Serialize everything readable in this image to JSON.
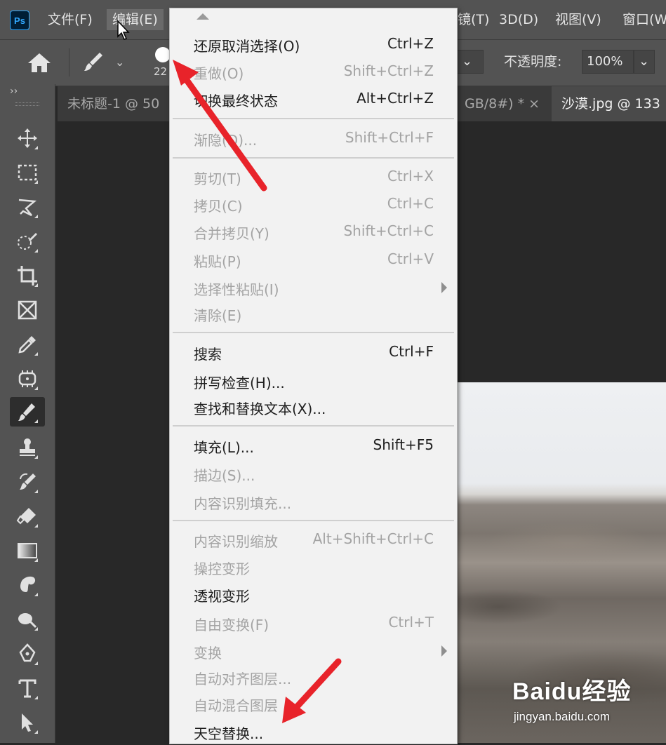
{
  "app": {
    "logo_text": "Ps"
  },
  "menubar": {
    "items": [
      "文件(F)",
      "编辑(E)",
      "镜(T)",
      "3D(D)",
      "视图(V)",
      "窗口(W"
    ]
  },
  "options": {
    "brush_size": "22",
    "opacity_label": "不透明度:",
    "opacity_value": "100%"
  },
  "tabs": [
    {
      "label": "未标题-1 @ 50",
      "active": false
    },
    {
      "label": "GB/8#) * ×",
      "active": false
    },
    {
      "label": "沙漠.jpg @ 133",
      "active": true
    }
  ],
  "toolbar": {
    "expand_label": "››",
    "tools": [
      "move-tool",
      "marquee-tool",
      "lasso-tool",
      "quick-selection-tool",
      "crop-tool",
      "frame-tool",
      "eyedropper-tool",
      "healing-tool",
      "brush-tool",
      "stamp-tool",
      "history-brush-tool",
      "eraser-tool",
      "gradient-tool",
      "blur-tool",
      "dodge-tool",
      "pen-tool",
      "type-tool",
      "path-selection-tool"
    ],
    "active": "brush-tool"
  },
  "edit_menu": {
    "items": [
      {
        "label": "还原取消选择(O)",
        "shortcut": "Ctrl+Z",
        "enabled": true
      },
      {
        "label": "重做(O)",
        "shortcut": "Shift+Ctrl+Z",
        "enabled": false
      },
      {
        "label": "切换最终状态",
        "shortcut": "Alt+Ctrl+Z",
        "enabled": true
      },
      {
        "label": "渐隐(D)...",
        "shortcut": "Shift+Ctrl+F",
        "enabled": false
      },
      {
        "label": "剪切(T)",
        "shortcut": "Ctrl+X",
        "enabled": false
      },
      {
        "label": "拷贝(C)",
        "shortcut": "Ctrl+C",
        "enabled": false
      },
      {
        "label": "合并拷贝(Y)",
        "shortcut": "Shift+Ctrl+C",
        "enabled": false
      },
      {
        "label": "粘贴(P)",
        "shortcut": "Ctrl+V",
        "enabled": false
      },
      {
        "label": "选择性粘贴(I)",
        "shortcut": "",
        "enabled": false,
        "submenu": true
      },
      {
        "label": "清除(E)",
        "shortcut": "",
        "enabled": false
      },
      {
        "label": "搜索",
        "shortcut": "Ctrl+F",
        "enabled": true
      },
      {
        "label": "拼写检查(H)...",
        "shortcut": "",
        "enabled": true
      },
      {
        "label": "查找和替换文本(X)...",
        "shortcut": "",
        "enabled": true
      },
      {
        "label": "填充(L)...",
        "shortcut": "Shift+F5",
        "enabled": true
      },
      {
        "label": "描边(S)...",
        "shortcut": "",
        "enabled": false
      },
      {
        "label": "内容识别填充...",
        "shortcut": "",
        "enabled": false
      },
      {
        "label": "内容识别缩放",
        "shortcut": "Alt+Shift+Ctrl+C",
        "enabled": false
      },
      {
        "label": "操控变形",
        "shortcut": "",
        "enabled": false
      },
      {
        "label": "透视变形",
        "shortcut": "",
        "enabled": true
      },
      {
        "label": "自由变换(F)",
        "shortcut": "Ctrl+T",
        "enabled": false
      },
      {
        "label": "变换",
        "shortcut": "",
        "enabled": false,
        "submenu": true
      },
      {
        "label": "自动对齐图层...",
        "shortcut": "",
        "enabled": false
      },
      {
        "label": "自动混合图层",
        "shortcut": "",
        "enabled": false
      },
      {
        "label": "天空替换...",
        "shortcut": "",
        "enabled": true
      }
    ]
  },
  "watermark": {
    "logo": "Baidu经验",
    "url": "jingyan.baidu.com"
  },
  "colors": {
    "accent_red": "#e8232a",
    "menu_bg": "#f2f2f2",
    "chrome": "#535353"
  }
}
